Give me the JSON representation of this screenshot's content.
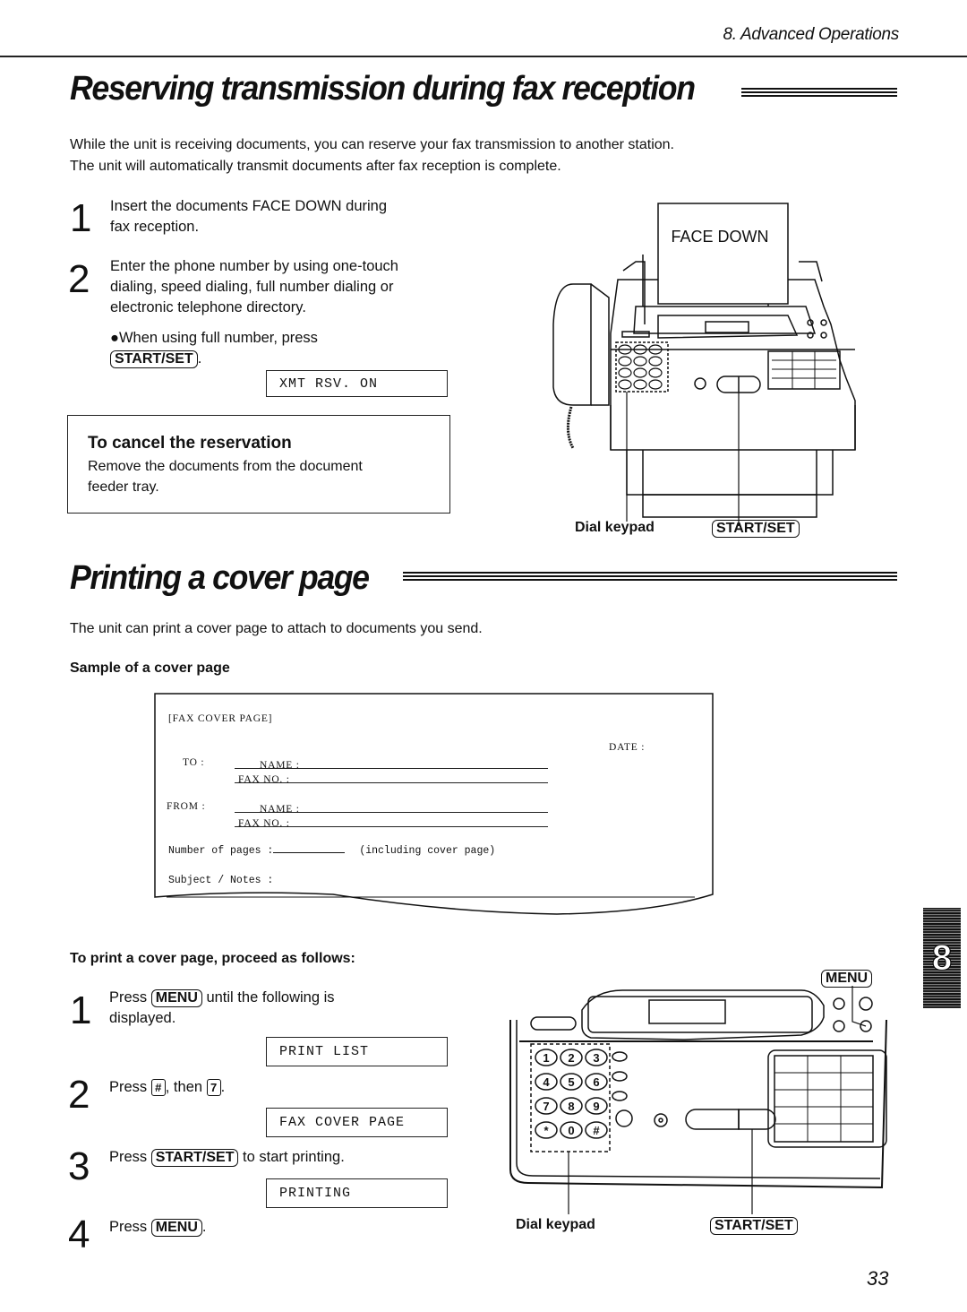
{
  "header": {
    "section_label": "8.  Advanced Operations"
  },
  "reserve": {
    "title": "Reserving transmission during fax reception",
    "intro_line1": "While the unit is receiving documents, you can reserve your fax transmission to another station.",
    "intro_line2": "The unit will automatically transmit documents after fax reception is complete.",
    "steps": [
      {
        "num": "1",
        "line1": "Insert the documents FACE DOWN during",
        "line2": "fax reception."
      },
      {
        "num": "2",
        "line1": "Enter the phone number by using one-touch",
        "line2": "dialing, speed dialing, full number dialing or",
        "line3": "electronic telephone directory."
      }
    ],
    "bullet_text": "●When using full number, press",
    "bullet_key": "START/SET",
    "bullet_end": ".",
    "lcd": "XMT RSV. ON",
    "cancel": {
      "title": "To cancel the reservation",
      "line1": "Remove the documents from the document",
      "line2": "feeder tray."
    },
    "figure": {
      "paper_label": "FACE DOWN",
      "callout_keypad": "Dial keypad",
      "callout_start": "START/SET"
    }
  },
  "cover": {
    "title": "Printing a cover page",
    "intro": "The unit can print a cover page to attach to documents you send.",
    "sample_label": "Sample of a cover page",
    "sample": {
      "heading": "[FAX COVER PAGE]",
      "date_label": "DATE  :",
      "to_label": "TO  :",
      "from_label": "FROM  :",
      "name_label": "NAME  :",
      "faxno_label": "FAX NO.  :",
      "pages_label": "Number of pages  :",
      "pages_note": "(including cover page)",
      "subject_label": "Subject / Notes  :"
    },
    "proceed_label": "To print a cover page, proceed as follows:",
    "steps": [
      {
        "num": "1",
        "pre": "Press ",
        "key": "MENU",
        "post": " until the following is",
        "line2": "displayed.",
        "lcd": "PRINT LIST"
      },
      {
        "num": "2",
        "pre": "Press ",
        "key": "#",
        "mid": ", then ",
        "key2": "7",
        "post": ".",
        "lcd": "FAX COVER PAGE"
      },
      {
        "num": "3",
        "pre": "Press ",
        "key": "START/SET",
        "post": " to start printing.",
        "lcd": "PRINTING"
      },
      {
        "num": "4",
        "pre": "Press ",
        "key": "MENU",
        "post": "."
      }
    ],
    "figure": {
      "callout_menu": "MENU",
      "callout_keypad": "Dial keypad",
      "callout_start": "START/SET",
      "keypad_keys": [
        "1",
        "2",
        "3",
        "4",
        "5",
        "6",
        "7",
        "8",
        "9",
        "*",
        "0",
        "#"
      ]
    }
  },
  "chapter_tab": "8",
  "page_number": "33"
}
